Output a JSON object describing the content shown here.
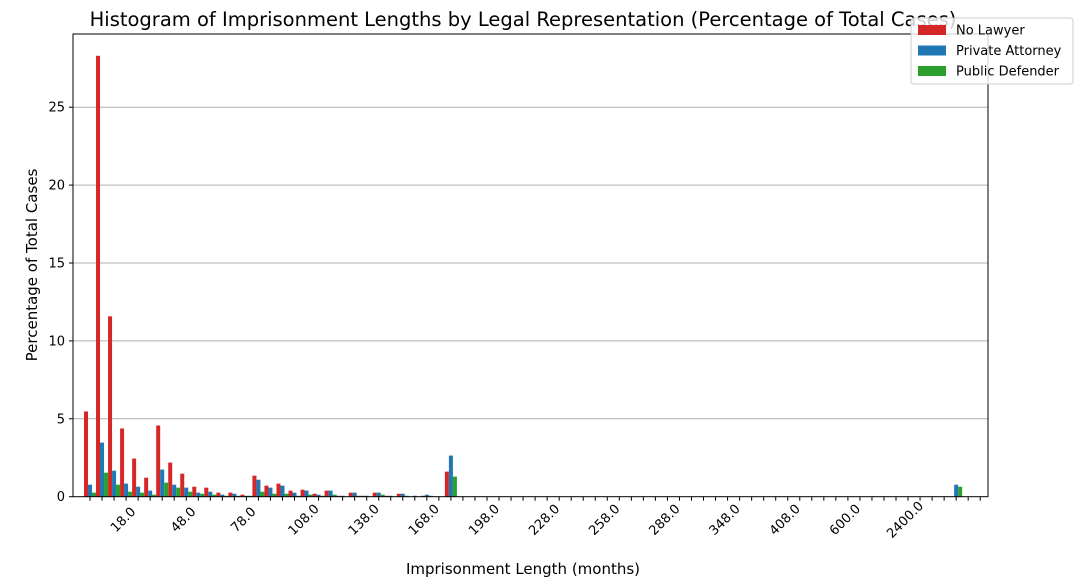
{
  "chart_data": {
    "type": "bar",
    "title": "Histogram of Imprisonment Lengths by Legal Representation (Percentage of Total Cases)",
    "xlabel": "Imprisonment Length (months)",
    "ylabel": "Percentage of Total Cases",
    "ylim": [
      0,
      29.7
    ],
    "yticks": [
      0,
      5,
      10,
      15,
      20,
      25
    ],
    "grid": "y",
    "legend_position": "top-right",
    "category_count": 75,
    "xtick_labels": [
      {
        "index": 3,
        "label": "18.0"
      },
      {
        "index": 8,
        "label": "48.0"
      },
      {
        "index": 13,
        "label": "78.0"
      },
      {
        "index": 18,
        "label": "108.0"
      },
      {
        "index": 23,
        "label": "138.0"
      },
      {
        "index": 28,
        "label": "168.0"
      },
      {
        "index": 33,
        "label": "198.0"
      },
      {
        "index": 38,
        "label": "228.0"
      },
      {
        "index": 43,
        "label": "258.0"
      },
      {
        "index": 48,
        "label": "288.0"
      },
      {
        "index": 53,
        "label": "348.0"
      },
      {
        "index": 58,
        "label": "408.0"
      },
      {
        "index": 63,
        "label": "600.0"
      },
      {
        "index": 68,
        "label": "2400.0"
      }
    ],
    "series": [
      {
        "name": "No Lawyer",
        "color": "#d62728",
        "points": [
          [
            0,
            5.47
          ],
          [
            1,
            28.3
          ],
          [
            2,
            11.58
          ],
          [
            3,
            4.38
          ],
          [
            4,
            2.45
          ],
          [
            5,
            1.22
          ],
          [
            6,
            4.57
          ],
          [
            7,
            2.19
          ],
          [
            8,
            1.48
          ],
          [
            9,
            0.64
          ],
          [
            10,
            0.58
          ],
          [
            11,
            0.26
          ],
          [
            12,
            0.26
          ],
          [
            13,
            0.13
          ],
          [
            14,
            1.35
          ],
          [
            15,
            0.71
          ],
          [
            16,
            0.84
          ],
          [
            17,
            0.39
          ],
          [
            18,
            0.45
          ],
          [
            19,
            0.19
          ],
          [
            20,
            0.39
          ],
          [
            21,
            0.06
          ],
          [
            22,
            0.26
          ],
          [
            23,
            0.06
          ],
          [
            24,
            0.26
          ],
          [
            25,
            0.06
          ],
          [
            26,
            0.19
          ],
          [
            28,
            0.06
          ],
          [
            30,
            1.61
          ]
        ]
      },
      {
        "name": "Private Attorney",
        "color": "#1f77b4",
        "points": [
          [
            0,
            0.77
          ],
          [
            1,
            3.47
          ],
          [
            2,
            1.67
          ],
          [
            3,
            0.84
          ],
          [
            4,
            0.64
          ],
          [
            5,
            0.39
          ],
          [
            6,
            1.74
          ],
          [
            7,
            0.77
          ],
          [
            8,
            0.58
          ],
          [
            9,
            0.26
          ],
          [
            10,
            0.32
          ],
          [
            11,
            0.13
          ],
          [
            12,
            0.19
          ],
          [
            13,
            0.06
          ],
          [
            14,
            1.09
          ],
          [
            15,
            0.58
          ],
          [
            16,
            0.71
          ],
          [
            17,
            0.26
          ],
          [
            18,
            0.39
          ],
          [
            19,
            0.13
          ],
          [
            20,
            0.39
          ],
          [
            21,
            0.06
          ],
          [
            22,
            0.26
          ],
          [
            23,
            0.06
          ],
          [
            24,
            0.26
          ],
          [
            25,
            0.06
          ],
          [
            26,
            0.19
          ],
          [
            27,
            0.06
          ],
          [
            28,
            0.13
          ],
          [
            30,
            2.64
          ],
          [
            72,
            0.77
          ]
        ]
      },
      {
        "name": "Public Defender",
        "color": "#2ca02c",
        "points": [
          [
            0,
            0.26
          ],
          [
            1,
            1.54
          ],
          [
            2,
            0.77
          ],
          [
            3,
            0.32
          ],
          [
            4,
            0.26
          ],
          [
            5,
            0.13
          ],
          [
            6,
            0.9
          ],
          [
            7,
            0.58
          ],
          [
            8,
            0.32
          ],
          [
            9,
            0.19
          ],
          [
            10,
            0.13
          ],
          [
            11,
            0.06
          ],
          [
            12,
            0.06
          ],
          [
            13,
            0.06
          ],
          [
            14,
            0.32
          ],
          [
            15,
            0.19
          ],
          [
            16,
            0.19
          ],
          [
            17,
            0.06
          ],
          [
            18,
            0.13
          ],
          [
            19,
            0.06
          ],
          [
            20,
            0.13
          ],
          [
            22,
            0.06
          ],
          [
            24,
            0.13
          ],
          [
            26,
            0.06
          ],
          [
            28,
            0.06
          ],
          [
            30,
            1.29
          ],
          [
            72,
            0.64
          ]
        ]
      }
    ]
  }
}
